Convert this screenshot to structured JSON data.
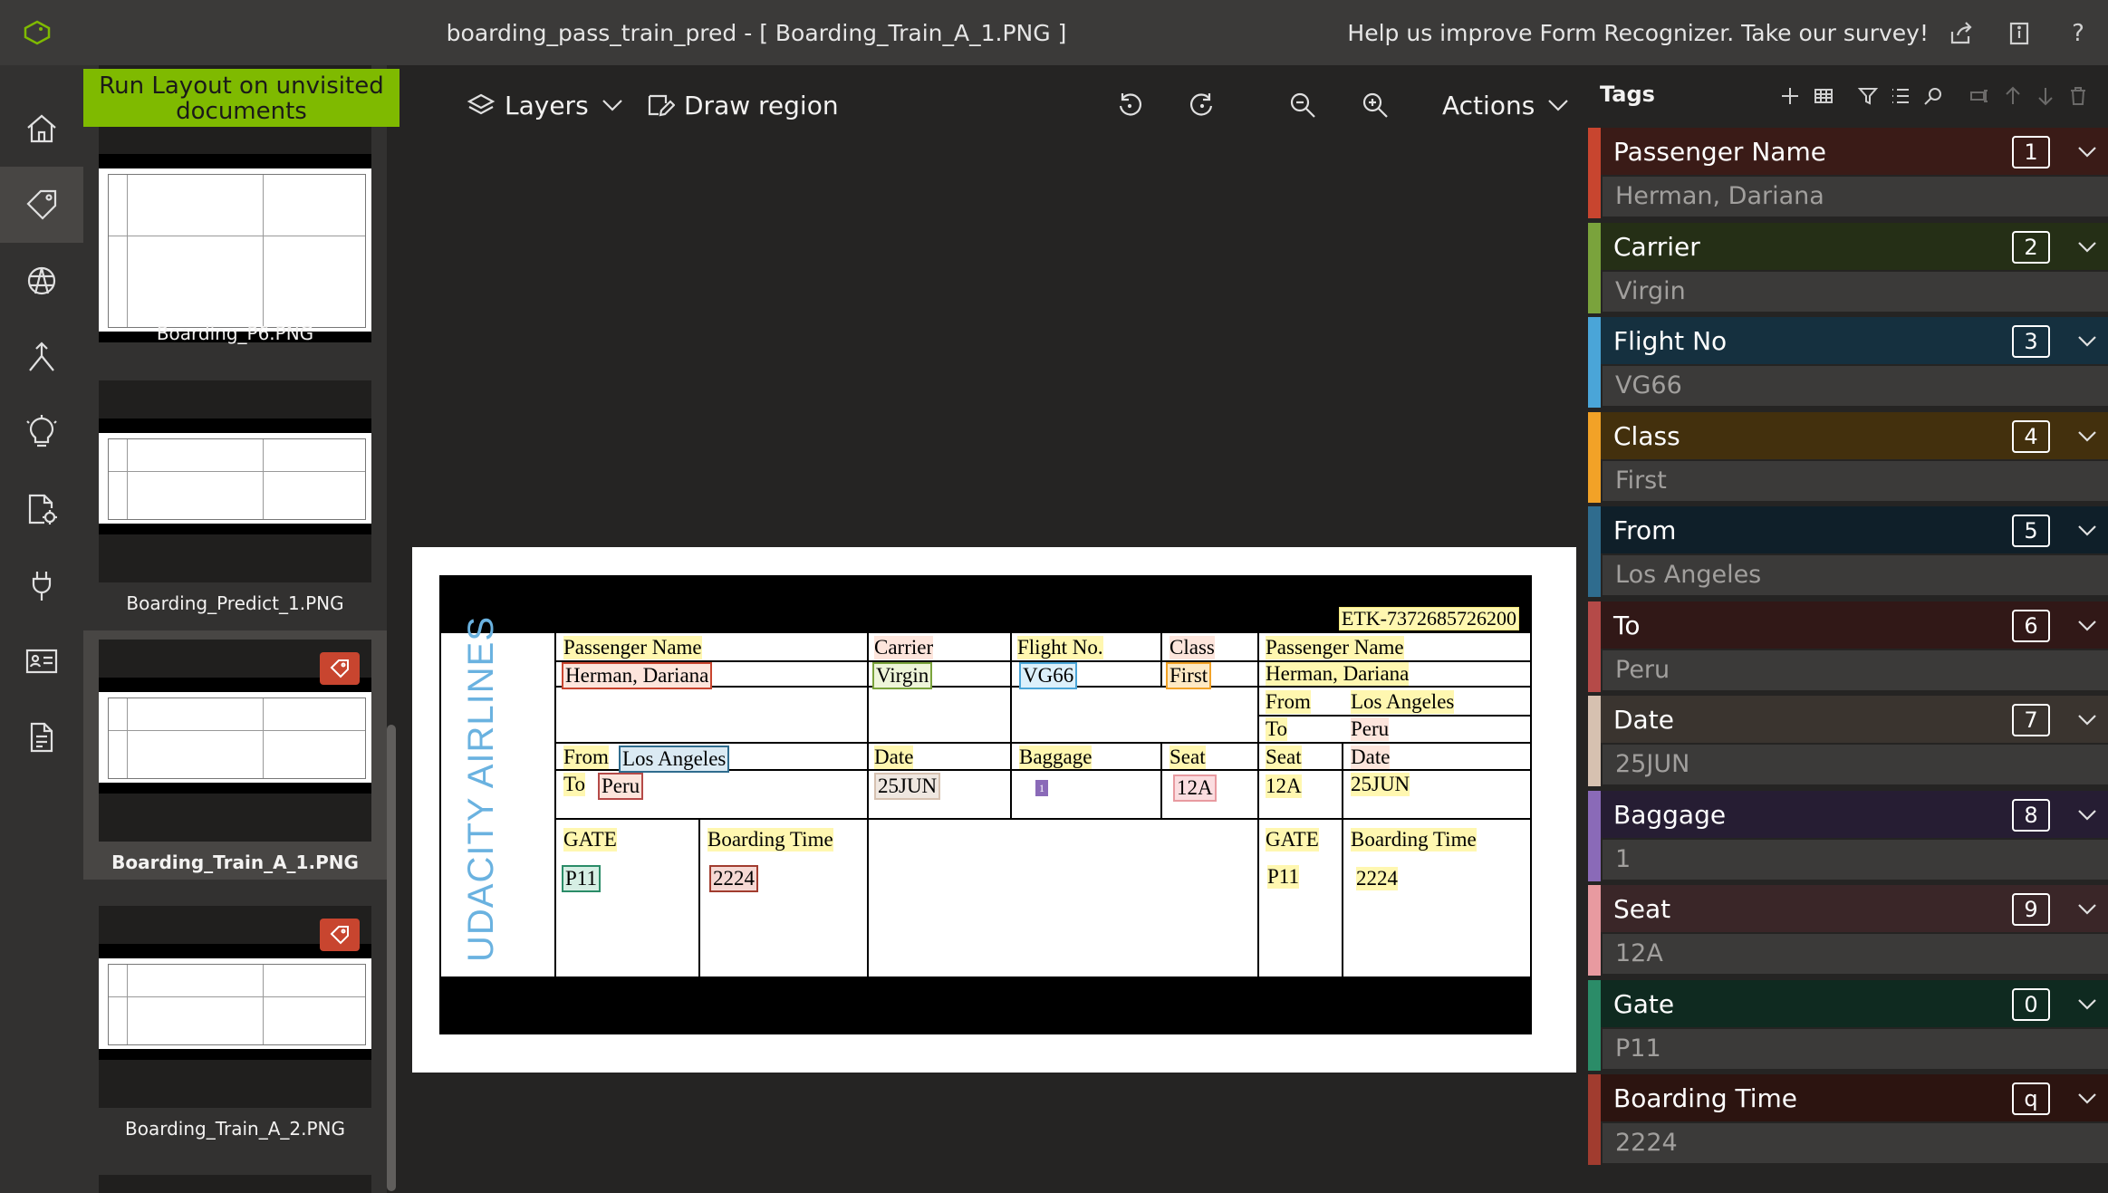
{
  "titlebar": {
    "title": "boarding_pass_train_pred - [ Boarding_Train_A_1.PNG ]",
    "survey": "Help us improve Form Recognizer. Take our survey!",
    "help": "?"
  },
  "leftnav": {
    "items": [
      "home-icon",
      "tag-icon",
      "model-icon",
      "merge-icon",
      "lightbulb-icon",
      "document-settings-icon",
      "plug-icon",
      "id-card-icon",
      "document-icon"
    ]
  },
  "filepane": {
    "run_layout": "Run Layout on unvisited documents",
    "files": [
      {
        "name": "Boarding_P6.PNG",
        "tagged": false,
        "selected": false
      },
      {
        "name": "Boarding_Predict_1.PNG",
        "tagged": false,
        "selected": false
      },
      {
        "name": "Boarding_Train_A_1.PNG",
        "tagged": true,
        "selected": true
      },
      {
        "name": "Boarding_Train_A_2.PNG",
        "tagged": true,
        "selected": false
      }
    ]
  },
  "toolbar": {
    "layers": "Layers",
    "draw_region": "Draw region",
    "actions": "Actions"
  },
  "document": {
    "etk": "ETK-7372685726200",
    "airline": "UDACITY AIRLINES",
    "labels": {
      "passenger_name": "Passenger Name",
      "carrier": "Carrier",
      "flight_no": "Flight No.",
      "class": "Class",
      "from": "From",
      "to": "To",
      "date": "Date",
      "baggage": "Baggage",
      "seat": "Seat",
      "gate": "GATE",
      "boarding_time": "Boarding Time"
    },
    "values": {
      "passenger": "Herman, Dariana",
      "carrier": "Virgin",
      "flight": "VG66",
      "class": "First",
      "from": "Los Angeles",
      "to": "Peru",
      "date": "25JUN",
      "baggage": "1",
      "seat": "12A",
      "gate": "P11",
      "boarding_time": "2224"
    }
  },
  "tags": {
    "header": "Tags",
    "items": [
      {
        "name": "Passenger Name",
        "key": "1",
        "value": "Herman, Dariana",
        "color": "#c8452f",
        "bg": "#3a1b17"
      },
      {
        "name": "Carrier",
        "key": "2",
        "value": "Virgin",
        "color": "#7aa33c",
        "bg": "#252f16"
      },
      {
        "name": "Flight No",
        "key": "3",
        "value": "VG66",
        "color": "#4aa5d8",
        "bg": "#15303f"
      },
      {
        "name": "Class",
        "key": "4",
        "value": "First",
        "color": "#f2a227",
        "bg": "#43300d"
      },
      {
        "name": "From",
        "key": "5",
        "value": "Los Angeles",
        "color": "#2f6c8e",
        "bg": "#0f1f29"
      },
      {
        "name": "To",
        "key": "6",
        "value": "Peru",
        "color": "#b54a48",
        "bg": "#311817"
      },
      {
        "name": "Date",
        "key": "7",
        "value": "25JUN",
        "color": "#d6c1b0",
        "bg": "#3a342f"
      },
      {
        "name": "Baggage",
        "key": "8",
        "value": "1",
        "color": "#8a6ab8",
        "bg": "#261d33"
      },
      {
        "name": "Seat",
        "key": "9",
        "value": "12A",
        "color": "#e89aa0",
        "bg": "#3a2628"
      },
      {
        "name": "Gate",
        "key": "0",
        "value": "P11",
        "color": "#2b8c68",
        "bg": "#0f2a20"
      },
      {
        "name": "Boarding Time",
        "key": "q",
        "value": "2224",
        "color": "#a13c2f",
        "bg": "#2c1410"
      }
    ]
  }
}
